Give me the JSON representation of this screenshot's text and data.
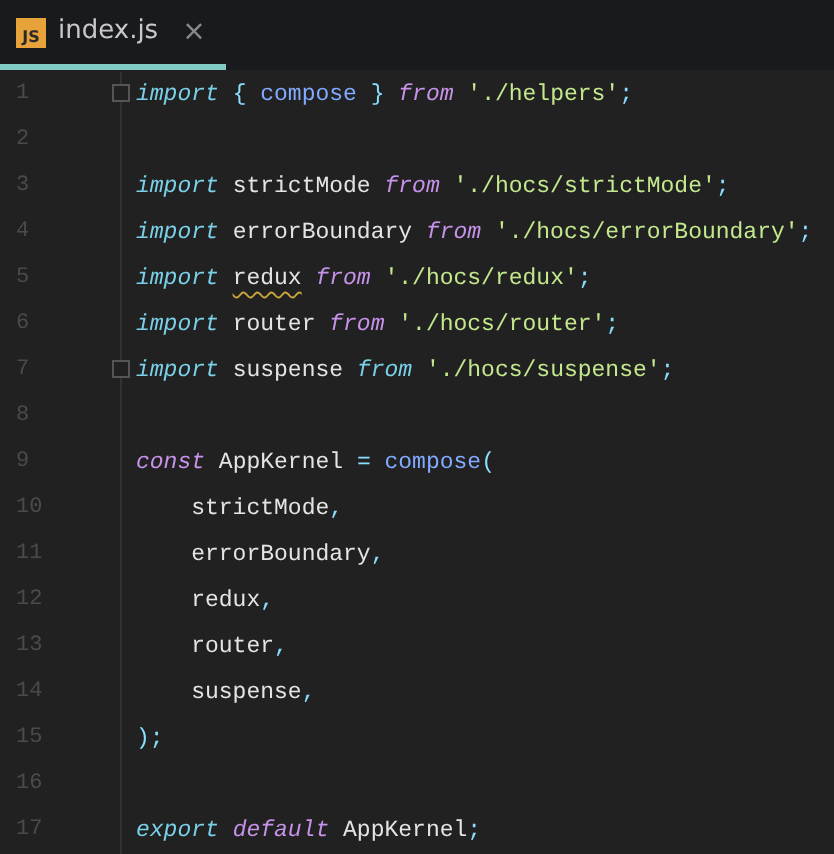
{
  "tabs": [
    {
      "icon_text": "JS",
      "label": "index.js",
      "close": "×",
      "selected": true
    }
  ],
  "lines": [
    {
      "number": "1",
      "fold": true,
      "tokens": [
        {
          "text": "import ",
          "kind": "keyword"
        },
        {
          "text": "{",
          "kind": "punct"
        },
        {
          "text": " compose ",
          "kind": "func"
        },
        {
          "text": "} ",
          "kind": "punct"
        },
        {
          "text": "from ",
          "kind": "keyword2"
        },
        {
          "text": "'./helpers'",
          "kind": "string"
        },
        {
          "text": ";",
          "kind": "punct"
        }
      ]
    },
    {
      "number": "2",
      "fold": false
    },
    {
      "number": "3",
      "fold": false,
      "tokens": [
        {
          "text": "import ",
          "kind": "keyword"
        },
        {
          "text": "strictMode ",
          "kind": "plain"
        },
        {
          "text": "from ",
          "kind": "keyword2"
        },
        {
          "text": "'./hocs/strictMode'",
          "kind": "string"
        },
        {
          "text": ";",
          "kind": "punct"
        }
      ]
    },
    {
      "number": "4",
      "fold": false,
      "tokens": [
        {
          "text": "import ",
          "kind": "keyword"
        },
        {
          "text": "errorBoundary ",
          "kind": "plain"
        },
        {
          "text": "from ",
          "kind": "keyword2"
        },
        {
          "text": "'./hocs/errorBoundary'",
          "kind": "string"
        },
        {
          "text": ";",
          "kind": "punct"
        }
      ]
    },
    {
      "number": "5",
      "fold": false,
      "tokens": [
        {
          "text": "import ",
          "kind": "keyword"
        },
        {
          "text": "redux",
          "kind": "plain",
          "warning": true
        },
        {
          "text": " from ",
          "kind": "keyword2"
        },
        {
          "text": "'./hocs/redux'",
          "kind": "string"
        },
        {
          "text": ";",
          "kind": "punct"
        }
      ]
    },
    {
      "number": "6",
      "fold": false,
      "tokens": [
        {
          "text": "import ",
          "kind": "keyword"
        },
        {
          "text": "router ",
          "kind": "plain"
        },
        {
          "text": "from ",
          "kind": "keyword2"
        },
        {
          "text": "'./hocs/router'",
          "kind": "string"
        },
        {
          "text": ";",
          "kind": "punct"
        }
      ]
    },
    {
      "number": "7",
      "fold": true,
      "tokens": [
        {
          "text": "import ",
          "kind": "keyword"
        },
        {
          "text": "suspense ",
          "kind": "plain"
        },
        {
          "text": "from ",
          "kind": "keyword"
        },
        {
          "text": "'./hocs/suspense'",
          "kind": "string"
        },
        {
          "text": ";",
          "kind": "punct"
        }
      ]
    },
    {
      "number": "8",
      "fold": false
    },
    {
      "number": "9",
      "fold": false,
      "tokens": [
        {
          "text": "const ",
          "kind": "keyword2"
        },
        {
          "text": "AppKernel ",
          "kind": "plain"
        },
        {
          "text": "= ",
          "kind": "punct"
        },
        {
          "text": "compose",
          "kind": "func"
        },
        {
          "text": "(",
          "kind": "punct"
        }
      ]
    },
    {
      "number": "10",
      "fold": false,
      "tokens": [
        {
          "text": "    strictMode",
          "kind": "plain"
        },
        {
          "text": ",",
          "kind": "punct"
        }
      ]
    },
    {
      "number": "11",
      "fold": false,
      "tokens": [
        {
          "text": "    errorBoundary",
          "kind": "plain"
        },
        {
          "text": ",",
          "kind": "punct"
        }
      ]
    },
    {
      "number": "12",
      "fold": false,
      "tokens": [
        {
          "text": "    redux",
          "kind": "plain"
        },
        {
          "text": ",",
          "kind": "punct"
        }
      ]
    },
    {
      "number": "13",
      "fold": false,
      "tokens": [
        {
          "text": "    router",
          "kind": "plain"
        },
        {
          "text": ",",
          "kind": "punct"
        }
      ]
    },
    {
      "number": "14",
      "fold": false,
      "tokens": [
        {
          "text": "    suspense",
          "kind": "plain"
        },
        {
          "text": ",",
          "kind": "punct"
        }
      ]
    },
    {
      "number": "15",
      "fold": false,
      "tokens": [
        {
          "text": ");",
          "kind": "punct"
        }
      ]
    },
    {
      "number": "16",
      "fold": false
    },
    {
      "number": "17",
      "fold": false,
      "tokens": [
        {
          "text": "export ",
          "kind": "keyword"
        },
        {
          "text": "default ",
          "kind": "keyword2"
        },
        {
          "text": "AppKernel",
          "kind": "plain"
        },
        {
          "text": ";",
          "kind": "punct"
        }
      ]
    }
  ]
}
